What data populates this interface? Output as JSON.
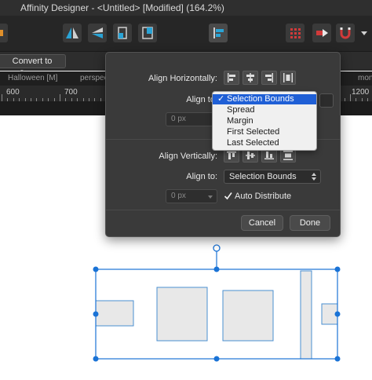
{
  "window": {
    "title": "Affinity Designer - <Untitled> [Modified] (164.2%)"
  },
  "context_toolbar": {
    "convert_label": "Convert to Curves"
  },
  "tab_row": {
    "items": [
      "Halloween [M]",
      "perspec",
      "mon"
    ]
  },
  "ruler": {
    "labels": [
      "600",
      "700",
      "1200"
    ]
  },
  "align_dialog": {
    "align_horizontally_label": "Align Horizontally:",
    "align_to_label_h": "Align to:",
    "h_spacing_value": "0 px",
    "align_vertically_label": "Align Vertically:",
    "align_to_label_v": "Align to:",
    "v_align_to_value": "Selection Bounds",
    "v_spacing_value": "0 px",
    "auto_distribute_label": "Auto Distribute",
    "auto_distribute_checked": true,
    "cancel_label": "Cancel",
    "done_label": "Done"
  },
  "align_to_menu": {
    "options": [
      "Selection Bounds",
      "Spread",
      "Margin",
      "First Selected",
      "Last Selected"
    ],
    "selected": "Selection Bounds",
    "check_glyph": "✓"
  },
  "colors": {
    "selection_blue": "#1a73d6",
    "menu_highlight": "#1f5fd6",
    "accent_red": "#d13a3a",
    "accent_cyan": "#2aa4d6"
  }
}
